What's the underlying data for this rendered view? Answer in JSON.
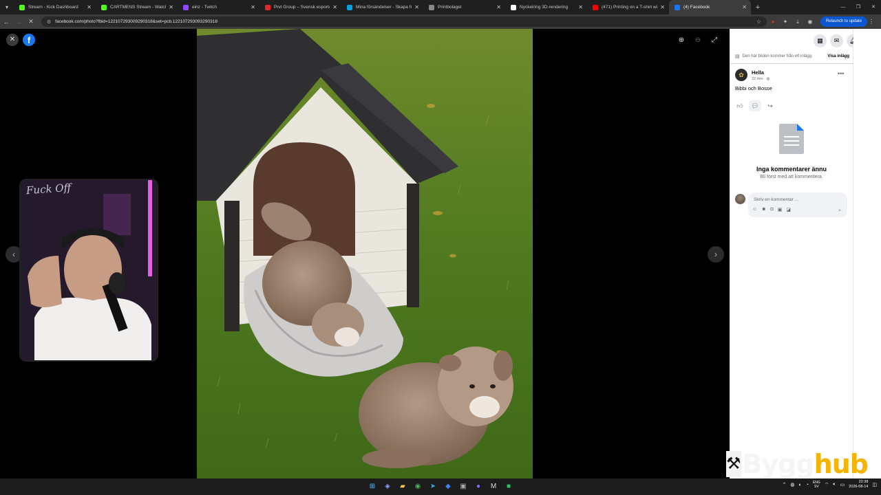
{
  "browser": {
    "tabs": [
      {
        "title": "Stream - Kick Dashboard",
        "color": "#53fc18"
      },
      {
        "title": "CARTMENS Stream - Watch Live",
        "color": "#53fc18"
      },
      {
        "title": "einz - Twitch",
        "color": "#9146ff"
      },
      {
        "title": "Prvt Group – Svensk esportorg",
        "color": "#e02828"
      },
      {
        "title": "Mina försändelser - Skapa frakt",
        "color": "#00a3e0"
      },
      {
        "title": "Printbolaget",
        "color": "#888888"
      },
      {
        "title": "Nyckelring 3D-rendering",
        "color": "#ffffff"
      },
      {
        "title": "(471) Printing on a T-shirt with",
        "color": "#ff0000"
      },
      {
        "title": "(4) Facebook",
        "color": "#1877f2",
        "active": true
      }
    ],
    "url": "facebook.com/photo?fbid=122107293009290318&set=pcb.122107293093290318",
    "relaunch_label": "Relaunch to update"
  },
  "viewer": {
    "close_icon": "close-icon",
    "prev_icon": "chevron-left-icon",
    "next_icon": "chevron-right-icon"
  },
  "panel": {
    "notice_text": "Den här bilden kommer från ett inlägg.",
    "notice_link": "Visa inlägg",
    "notifications_badge": "1",
    "post": {
      "author": "Hella",
      "time": "22 min ·",
      "text": "Bibbi och Bosse"
    },
    "empty_title": "Inga kommentarer ännu",
    "empty_subtitle": "Bli först med att kommentera.",
    "comment_placeholder": "Skriv en kommentar ..."
  },
  "webcam": {
    "neon_text": "Fuck Off"
  },
  "watermark": {
    "prefix": "Bygg",
    "suffix": "hub"
  },
  "taskbar": {
    "lang_top": "ENG",
    "lang_bottom": "SV",
    "time": "22:38",
    "date": "2026-08-14"
  },
  "colors": {
    "facebook_blue": "#1877f2",
    "relaunch_blue": "#0b57d0",
    "notification_red": "#e41e3f"
  }
}
